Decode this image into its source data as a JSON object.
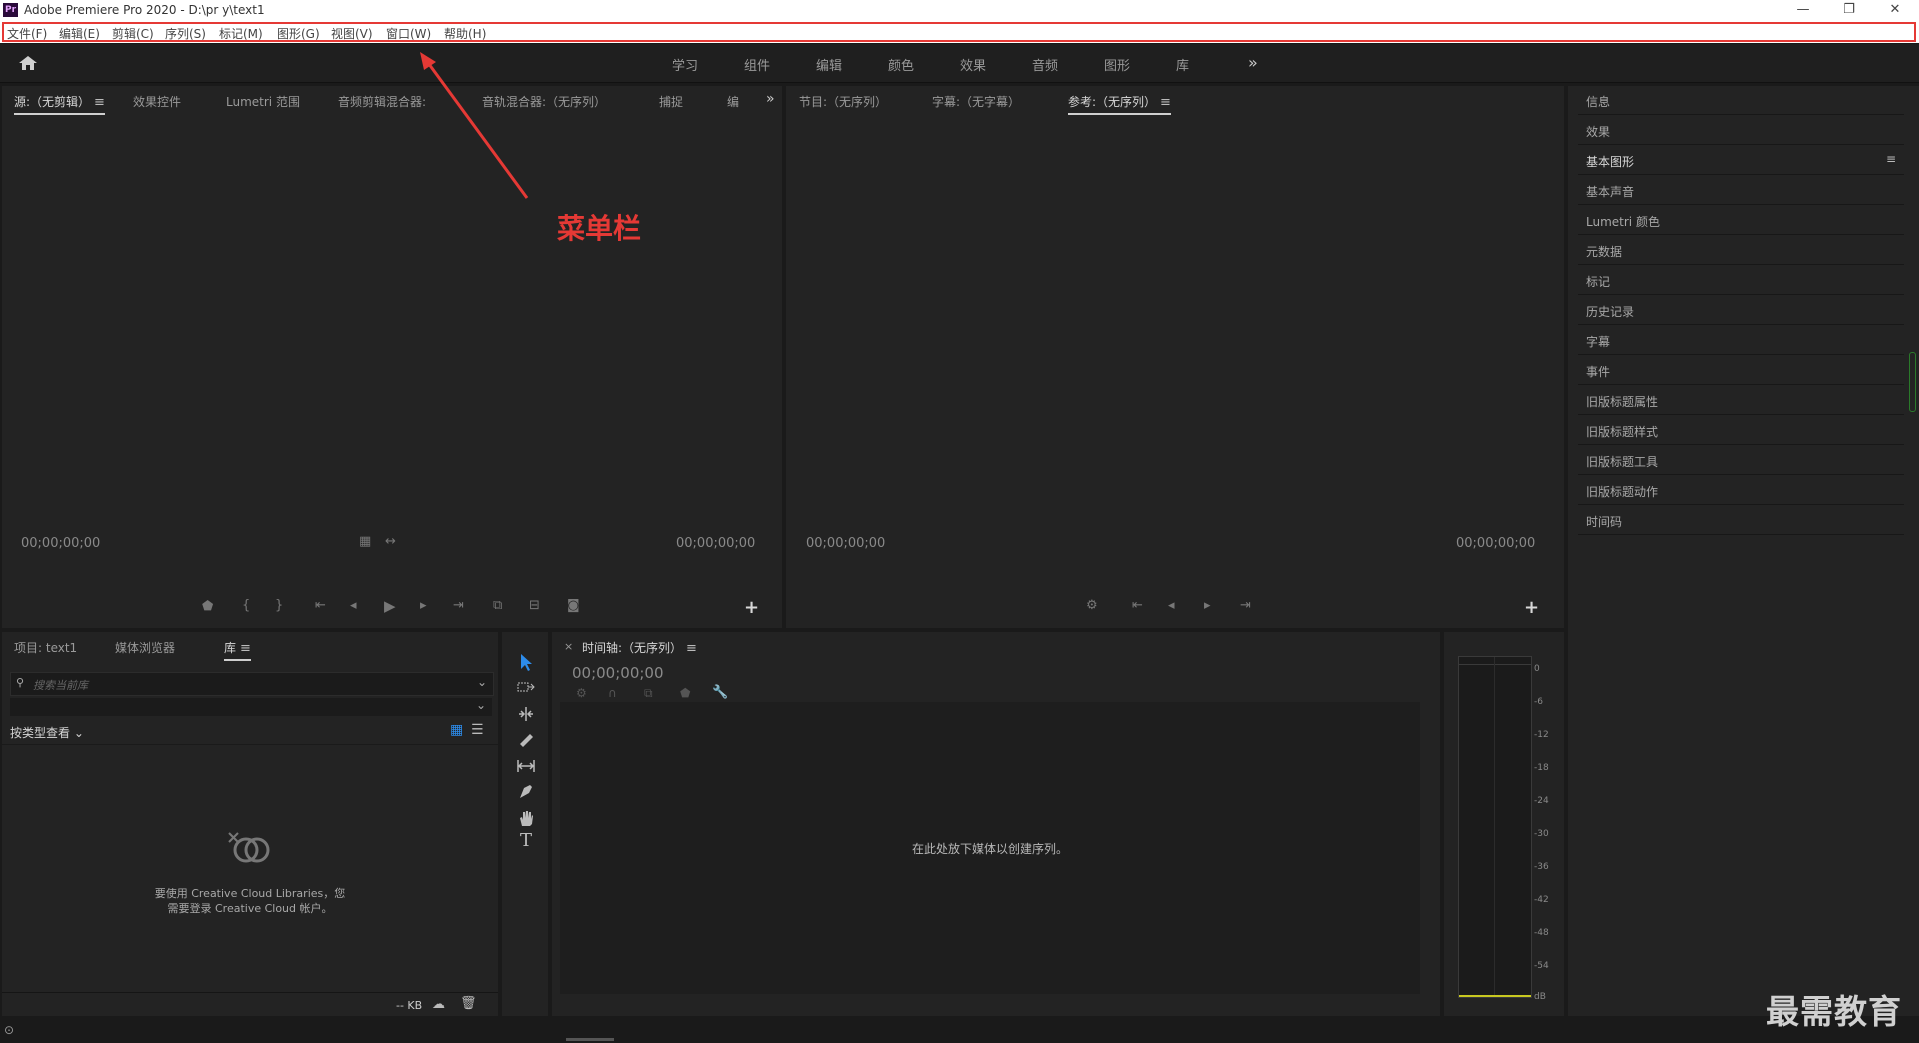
{
  "window": {
    "title": "Adobe Premiere Pro 2020 - D:\\pr y\\text1",
    "app_icon_text": "Pr",
    "controls": {
      "minimize": "—",
      "restore": "❐",
      "close": "✕"
    }
  },
  "menubar": {
    "items": [
      "文件(F)",
      "编辑(E)",
      "剪辑(C)",
      "序列(S)",
      "标记(M)",
      "图形(G)",
      "视图(V)",
      "窗口(W)",
      "帮助(H)"
    ]
  },
  "annotation": {
    "label": "菜单栏",
    "color": "#e53935"
  },
  "workspaces": {
    "items": [
      "学习",
      "组件",
      "编辑",
      "颜色",
      "效果",
      "音频",
      "图形",
      "库"
    ],
    "more": "»"
  },
  "source_panel": {
    "tabs": [
      "源:（无剪辑）",
      "效果控件",
      "Lumetri 范围",
      "音频剪辑混合器:",
      "音轨混合器:（无序列）",
      "捕捉",
      "编"
    ],
    "more": "»",
    "timecode_left": "00;00;00;00",
    "timecode_right": "00;00;00;00",
    "plus": "+"
  },
  "program_panel": {
    "tabs": [
      "节目:（无序列）",
      "字幕:（无字幕）",
      "参考:（无序列）"
    ],
    "timecode_left": "00;00;00;00",
    "timecode_right": "00;00;00;00",
    "plus": "+"
  },
  "right_panel": {
    "items": [
      "信息",
      "效果",
      "基本图形",
      "基本声音",
      "Lumetri 颜色",
      "元数据",
      "标记",
      "历史记录",
      "字幕",
      "事件",
      "旧版标题属性",
      "旧版标题样式",
      "旧版标题工具",
      "旧版标题动作",
      "时间码"
    ],
    "highlighted": "基本图形"
  },
  "project_panel": {
    "tabs": [
      "项目: text1",
      "媒体浏览器",
      "库"
    ],
    "search_placeholder": "搜索当前库",
    "view_by": "按类型查看",
    "message_line1": "要使用 Creative Cloud Libraries，您",
    "message_line2": "需要登录 Creative Cloud 帐户。",
    "size_label": "-- KB"
  },
  "timeline_panel": {
    "close": "×",
    "title": "时间轴:（无序列）",
    "timecode": "00;00;00;00",
    "empty_message": "在此处放下媒体以创建序列。"
  },
  "audio_meter": {
    "ticks": [
      "0",
      "-6",
      "-12",
      "-18",
      "-24",
      "-30",
      "-36",
      "-42",
      "-48",
      "-54",
      "dB"
    ]
  },
  "watermark": "最需教育",
  "colors": {
    "accent_blue": "#2d8ceb",
    "annotation_red": "#e53935",
    "meter_yellow": "#c8c820"
  }
}
